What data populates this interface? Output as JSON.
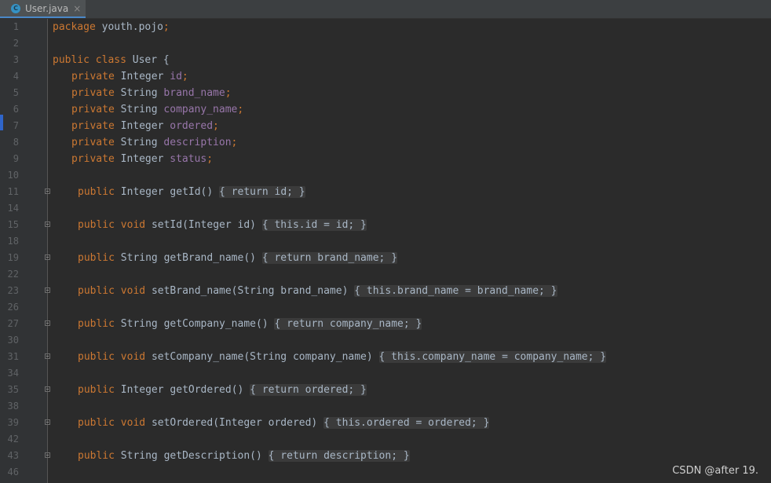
{
  "tab": {
    "icon": "c-class-icon",
    "label": "User.java",
    "close": "×"
  },
  "lines": [
    {
      "n": "1",
      "x": 67,
      "t": [
        [
          "kw",
          "package"
        ],
        [
          "",
          "youth.pojo"
        ],
        [
          "kw",
          ";"
        ]
      ]
    },
    {
      "n": "2",
      "x": 67,
      "t": []
    },
    {
      "n": "3",
      "x": 67,
      "t": [
        [
          "kw",
          "public"
        ],
        [
          "",
          ""
        ],
        [
          "kw",
          "class"
        ],
        [
          "",
          "User {"
        ]
      ]
    },
    {
      "n": "4",
      "x": 91,
      "t": [
        [
          "kw",
          "private"
        ],
        [
          "",
          "Integer"
        ],
        [
          "fld",
          "id"
        ],
        [
          "kw",
          ";"
        ]
      ]
    },
    {
      "n": "5",
      "x": 91,
      "t": [
        [
          "kw",
          "private"
        ],
        [
          "",
          "String"
        ],
        [
          "fld",
          "brand_name"
        ],
        [
          "kw",
          ";"
        ]
      ]
    },
    {
      "n": "6",
      "x": 91,
      "t": [
        [
          "kw",
          "private"
        ],
        [
          "",
          "String"
        ],
        [
          "fld",
          "company_name"
        ],
        [
          "kw",
          ";"
        ]
      ]
    },
    {
      "n": "7",
      "x": 91,
      "t": [
        [
          "kw",
          "private"
        ],
        [
          "",
          "Integer"
        ],
        [
          "fld",
          "ordered"
        ],
        [
          "kw",
          ";"
        ]
      ]
    },
    {
      "n": "8",
      "x": 91,
      "t": [
        [
          "kw",
          "private"
        ],
        [
          "",
          "String"
        ],
        [
          "fld",
          "description"
        ],
        [
          "kw",
          ";"
        ]
      ]
    },
    {
      "n": "9",
      "x": 91,
      "t": [
        [
          "kw",
          "private"
        ],
        [
          "",
          "Integer"
        ],
        [
          "fld",
          "status"
        ],
        [
          "kw",
          ";"
        ]
      ]
    },
    {
      "n": "10",
      "x": 91,
      "t": []
    },
    {
      "n": "11",
      "x": 99,
      "fold": true,
      "t": [
        [
          "kw",
          "public"
        ],
        [
          "",
          "Integer"
        ],
        [
          "meth",
          "getId()"
        ],
        [
          "fb",
          "{ return id; }"
        ]
      ]
    },
    {
      "n": "14",
      "x": 99,
      "t": []
    },
    {
      "n": "15",
      "x": 99,
      "fold": true,
      "t": [
        [
          "kw",
          "public"
        ],
        [
          "kw",
          "void"
        ],
        [
          "meth",
          "setId(Integer id)"
        ],
        [
          "fb",
          "{ this.id = id; }"
        ]
      ]
    },
    {
      "n": "18",
      "x": 99,
      "t": []
    },
    {
      "n": "19",
      "x": 99,
      "fold": true,
      "t": [
        [
          "kw",
          "public"
        ],
        [
          "",
          "String"
        ],
        [
          "meth",
          "getBrand_name()"
        ],
        [
          "fb",
          "{ return brand_name; }"
        ]
      ]
    },
    {
      "n": "22",
      "x": 99,
      "t": []
    },
    {
      "n": "23",
      "x": 99,
      "fold": true,
      "t": [
        [
          "kw",
          "public"
        ],
        [
          "kw",
          "void"
        ],
        [
          "meth",
          "setBrand_name(String brand_name)"
        ],
        [
          "fb",
          "{ this.brand_name = brand_name; }"
        ]
      ]
    },
    {
      "n": "26",
      "x": 99,
      "t": []
    },
    {
      "n": "27",
      "x": 99,
      "fold": true,
      "t": [
        [
          "kw",
          "public"
        ],
        [
          "",
          "String"
        ],
        [
          "meth",
          "getCompany_name()"
        ],
        [
          "fb",
          "{ return company_name; }"
        ]
      ]
    },
    {
      "n": "30",
      "x": 99,
      "t": []
    },
    {
      "n": "31",
      "x": 99,
      "fold": true,
      "t": [
        [
          "kw",
          "public"
        ],
        [
          "kw",
          "void"
        ],
        [
          "meth",
          "setCompany_name(String company_name)"
        ],
        [
          "fb",
          "{ this.company_name = company_name; }"
        ]
      ]
    },
    {
      "n": "34",
      "x": 99,
      "t": []
    },
    {
      "n": "35",
      "x": 99,
      "fold": true,
      "t": [
        [
          "kw",
          "public"
        ],
        [
          "",
          "Integer"
        ],
        [
          "meth",
          "getOrdered()"
        ],
        [
          "fb",
          "{ return ordered; }"
        ]
      ]
    },
    {
      "n": "38",
      "x": 99,
      "t": []
    },
    {
      "n": "39",
      "x": 99,
      "fold": true,
      "t": [
        [
          "kw",
          "public"
        ],
        [
          "kw",
          "void"
        ],
        [
          "meth",
          "setOrdered(Integer ordered)"
        ],
        [
          "fb",
          "{ this.ordered = ordered; }"
        ]
      ]
    },
    {
      "n": "42",
      "x": 99,
      "t": []
    },
    {
      "n": "43",
      "x": 99,
      "fold": true,
      "t": [
        [
          "kw",
          "public"
        ],
        [
          "",
          "String"
        ],
        [
          "meth",
          "getDescription()"
        ],
        [
          "fb",
          "{ return description; }"
        ]
      ]
    },
    {
      "n": "46",
      "x": 99,
      "t": []
    }
  ],
  "watermark": "CSDN @after 19."
}
